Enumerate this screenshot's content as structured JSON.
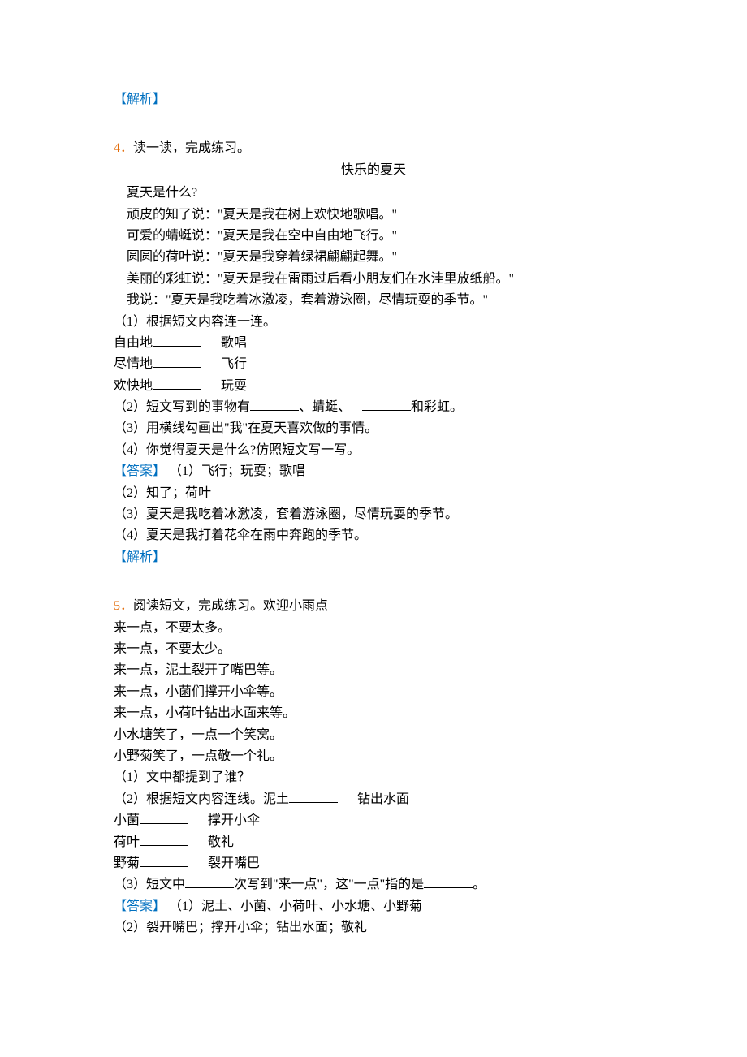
{
  "labels": {
    "jiexi": "【解析】",
    "daan": "【答案】"
  },
  "q4": {
    "num": "4．",
    "prompt": "读一读，完成练习。",
    "title": "快乐的夏天",
    "p1": "夏天是什么?",
    "p2": "顽皮的知了说：\"夏天是我在树上欢快地歌唱。\"",
    "p3": "可爱的蜻蜓说：\"夏天是我在空中自由地飞行。\"",
    "p4": "圆圆的荷叶说：\"夏天是我穿着绿裙翩翩起舞。\"",
    "p5": "美丽的彩虹说：\"夏天是我在雷雨过后看小朋友们在水洼里放纸船。\"",
    "p6": "我说：\"夏天是我吃着冰激凌，套着游泳圈，尽情玩耍的季节。\"",
    "s1": "（1）根据短文内容连一连。",
    "m1a": "自由地",
    "m1b": "歌唱",
    "m2a": "尽情地",
    "m2b": "飞行",
    "m3a": "欢快地",
    "m3b": "玩耍",
    "s2a": "（2）短文写到的事物有",
    "s2b": "、蜻蜓、",
    "s2c": "和彩虹。",
    "s3": "（3）用横线勾画出\"我\"在夏天喜欢做的事情。",
    "s4": "（4）你觉得夏天是什么?仿照短文写一写。",
    "a1": " （1）飞行；玩耍；歌唱",
    "a2": "（2）知了；荷叶",
    "a3": "（3）夏天是我吃着冰激凌，套着游泳圈，尽情玩耍的季节。",
    "a4": "（4）夏天是我打着花伞在雨中奔跑的季节。"
  },
  "q5": {
    "num": "5．",
    "prompt": "阅读短文，完成练习。欢迎小雨点",
    "l1": "来一点，不要太多。",
    "l2": "来一点，不要太少。",
    "l3": "来一点，泥土裂开了嘴巴等。",
    "l4": "来一点，小菌们撑开小伞等。",
    "l5": "来一点，小荷叶钻出水面来等。",
    "l6": "小水塘笑了，一点一个笑窝。",
    "l7": "小野菊笑了，一点敬一个礼。",
    "s1": "（1）文中都提到了谁？",
    "s2a": "（2）根据短文内容连线。泥土",
    "s2b": "钻出水面",
    "m1a": "小菌",
    "m1b": "撑开小伞",
    "m2a": "荷叶",
    "m2b": "敬礼",
    "m3a": "野菊",
    "m3b": "裂开嘴巴",
    "s3a": "（3）短文中",
    "s3b": "次写到\"来一点\"，这\"一点\"指的是",
    "s3c": "。",
    "a1": " （1）泥土、小菌、小荷叶、小水塘、小野菊",
    "a2": "（2）裂开嘴巴；撑开小伞；钻出水面；敬礼"
  }
}
